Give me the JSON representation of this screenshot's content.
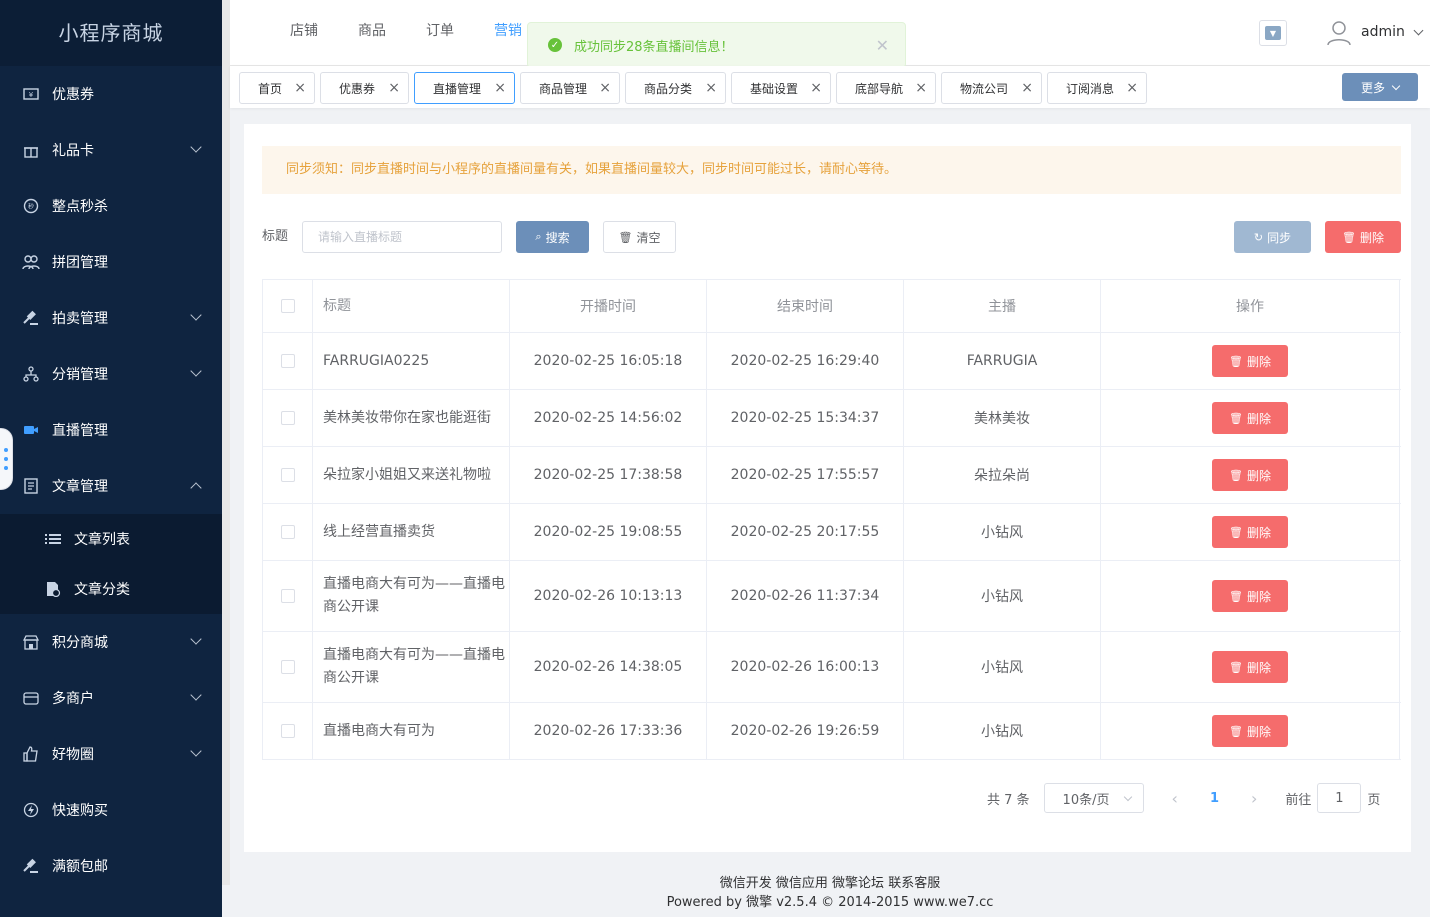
{
  "sidebar": {
    "logo": "小程序商城",
    "items": [
      {
        "label": "优惠券",
        "icon": "ticket-icon"
      },
      {
        "label": "礼品卡",
        "icon": "gift-icon"
      },
      {
        "label": "整点秒杀",
        "icon": "flash-sale-icon"
      },
      {
        "label": "拼团管理",
        "icon": "group-icon"
      },
      {
        "label": "拍卖管理",
        "icon": "gavel-icon"
      },
      {
        "label": "分销管理",
        "icon": "network-icon"
      },
      {
        "label": "直播管理",
        "icon": "video-icon"
      },
      {
        "label": "文章管理",
        "icon": "document-icon"
      },
      {
        "label": "文章列表",
        "icon": "list-icon"
      },
      {
        "label": "文章分类",
        "icon": "category-icon"
      },
      {
        "label": "积分商城",
        "icon": "store-icon"
      },
      {
        "label": "多商户",
        "icon": "shop-icon"
      },
      {
        "label": "好物圈",
        "icon": "thumbs-up-icon"
      },
      {
        "label": "快速购买",
        "icon": "lightning-icon"
      },
      {
        "label": "满额包邮",
        "icon": "shipping-icon"
      }
    ]
  },
  "topnav": {
    "items": [
      "店铺",
      "商品",
      "订单",
      "营销"
    ]
  },
  "toast": {
    "message": "成功同步28条直播间信息！"
  },
  "user": {
    "name": "admin"
  },
  "tabs": {
    "items": [
      "首页",
      "优惠券",
      "直播管理",
      "商品管理",
      "商品分类",
      "基础设置",
      "底部导航",
      "物流公司",
      "订阅消息"
    ],
    "more": "更多"
  },
  "notice": "同步须知：同步直播时间与小程序的直播间量有关，如果直播间量较大，同步时间可能过长，请耐心等待。",
  "filter": {
    "label": "标题",
    "placeholder": "请输入直播标题",
    "search": "搜索",
    "clear": "清空",
    "sync": "同步",
    "delete": "删除"
  },
  "table": {
    "headers": [
      "标题",
      "开播时间",
      "结束时间",
      "主播",
      "操作"
    ],
    "delete_label": "删除",
    "rows": [
      {
        "title": "FARRUGIA0225",
        "start": "2020-02-25 16:05:18",
        "end": "2020-02-25 16:29:40",
        "anchor": "FARRUGIA"
      },
      {
        "title": "美林美妆带你在家也能逛街",
        "start": "2020-02-25 14:56:02",
        "end": "2020-02-25 15:34:37",
        "anchor": "美林美妆"
      },
      {
        "title": "朵拉家小姐姐又来送礼物啦",
        "start": "2020-02-25 17:38:58",
        "end": "2020-02-25 17:55:57",
        "anchor": "朵拉朵尚"
      },
      {
        "title": "线上经营直播卖货",
        "start": "2020-02-25 19:08:55",
        "end": "2020-02-25 20:17:55",
        "anchor": "小钻风"
      },
      {
        "title": "直播电商大有可为——直播电商公开课",
        "start": "2020-02-26 10:13:13",
        "end": "2020-02-26 11:37:34",
        "anchor": "小钻风"
      },
      {
        "title": "直播电商大有可为——直播电商公开课",
        "start": "2020-02-26 14:38:05",
        "end": "2020-02-26 16:00:13",
        "anchor": "小钻风"
      },
      {
        "title": "直播电商大有可为",
        "start": "2020-02-26 17:33:36",
        "end": "2020-02-26 19:26:59",
        "anchor": "小钻风"
      }
    ]
  },
  "pagination": {
    "total": "共 7 条",
    "page_size": "10条/页",
    "current": "1",
    "goto_prefix": "前往",
    "goto_value": "1",
    "goto_suffix": "页"
  },
  "footer": {
    "links": "微信开发 微信应用 微擎论坛 联系客服",
    "powered": "Powered by 微擎 v2.5.4 © 2014-2015 www.we7.cc"
  },
  "colors": {
    "primary": "#409eff",
    "danger": "#f56c6c",
    "sidebar_bg": "#0f2440",
    "success": "#67c23a",
    "warning": "#e6a23c"
  }
}
